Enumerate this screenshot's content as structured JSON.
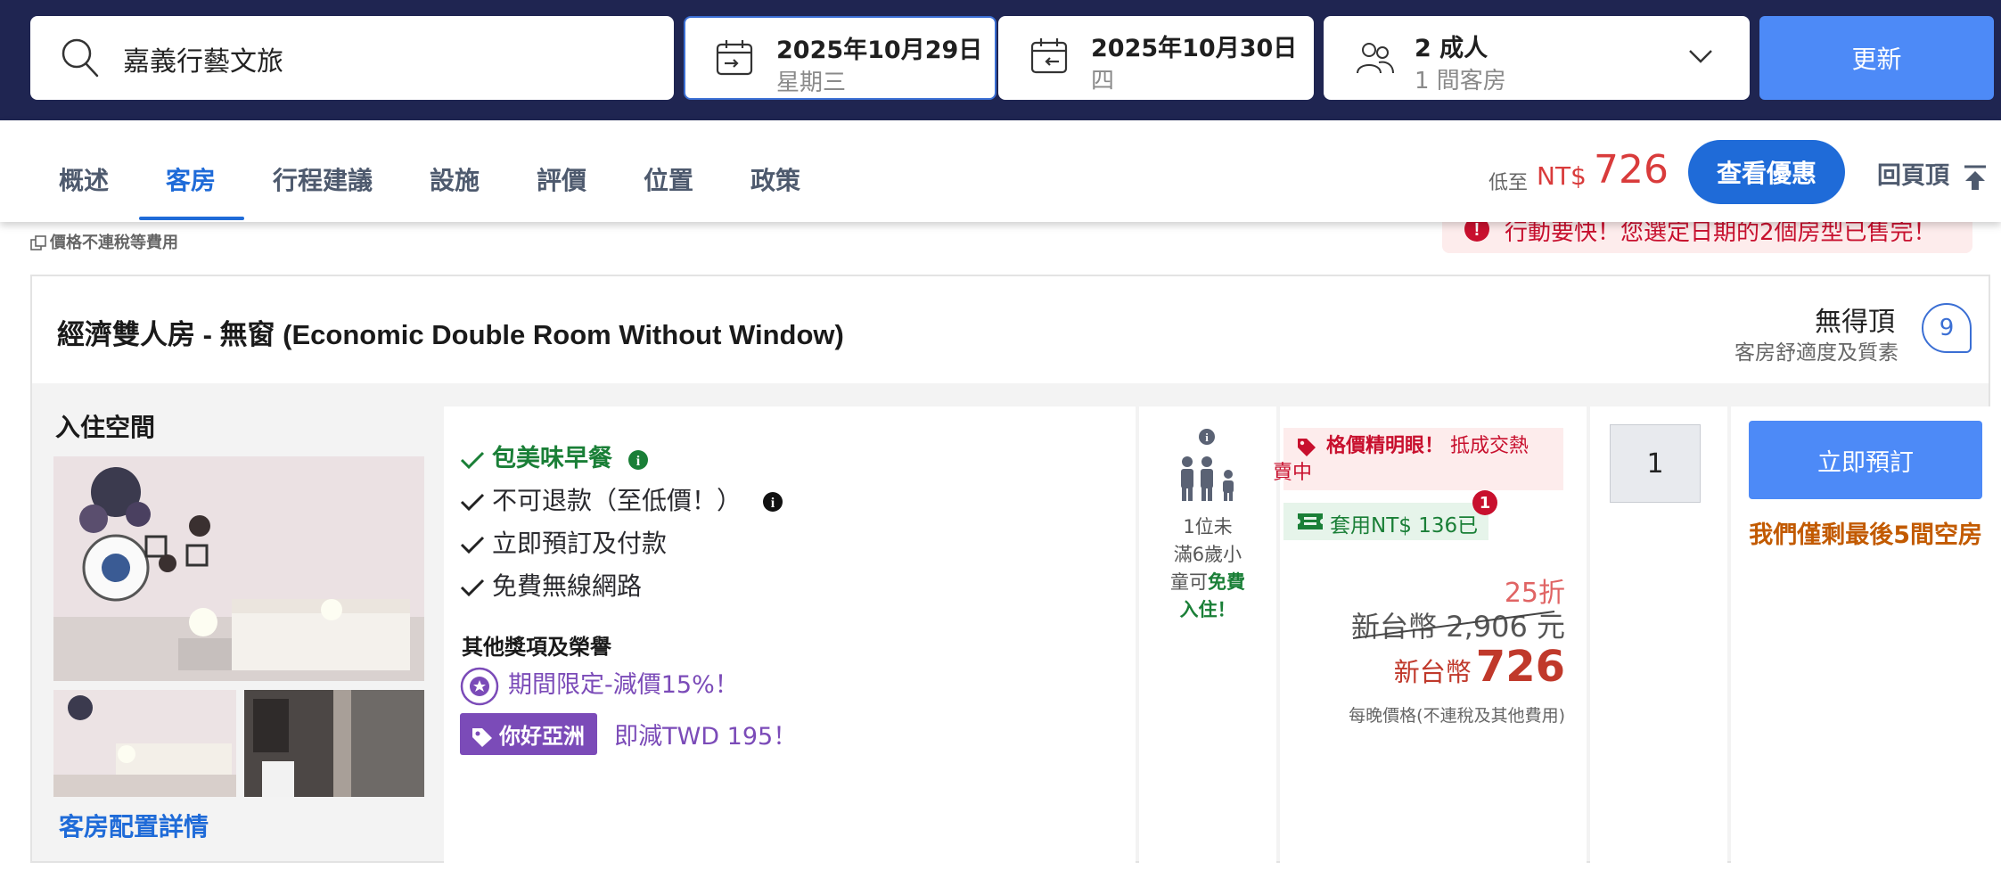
{
  "search": {
    "query": "嘉義行藝文旅",
    "icon": "search-icon"
  },
  "dates": {
    "checkin": {
      "date": "2025年10月29日",
      "weekday": "星期三"
    },
    "checkout": {
      "date": "2025年10月30日",
      "weekday": "四"
    }
  },
  "guests": {
    "adults": "2 成人",
    "rooms": "1 間客房"
  },
  "update_label": "更新",
  "tabs": [
    "概述",
    "客房",
    "行程建議",
    "設施",
    "評價",
    "位置",
    "政策"
  ],
  "active_tab": "客房",
  "header_price": {
    "prefix": "低至",
    "currency": "NT$",
    "amount": "726"
  },
  "see_deal_label": "查看優惠",
  "back_to_top_label": "回頁頂",
  "tax_note": "價格不連稅等費用",
  "urgent_banner": "行動要快！您選定日期的2個房型已售完！",
  "room": {
    "title": "經濟雙人房 - 無窗 (Economic Double Room Without Window)",
    "rating_text": "無得頂",
    "rating_sub": "客房舒適度及質素",
    "rating_score": "9",
    "space_label": "入住空間",
    "details_link": "客房配置詳情",
    "features": {
      "breakfast": "包美味早餐",
      "nonrefund": "不可退款（至低價！）",
      "instant": "立即預訂及付款",
      "wifi": "免費無線網路"
    },
    "awards_title": "其他獎項及榮譽",
    "award1": "期間限定-減價15%！",
    "award2_badge": "你好亞洲",
    "award2_text": "即減TWD 195！",
    "occupancy": {
      "line1": "1位未",
      "line2": "滿6歲小",
      "line3": "童可",
      "free": "免費",
      "line4": "入住！"
    },
    "deal_tag": {
      "bold": "格價精明眼！",
      "text": "抵成交熱",
      "text2": "賣中"
    },
    "coupon": {
      "text": "套用NT$ 136已",
      "count": "1"
    },
    "discount": "25折",
    "original_price": "新台幣 2,906 元",
    "final_price": {
      "prefix": "新台幣",
      "amount": "726"
    },
    "price_note": "每晚價格(不連稅及其他費用)",
    "qty": "1",
    "book_label": "立即預訂",
    "scarcity": "我們僅剩最後5間空房"
  },
  "colors": {
    "brand_blue": "#1f6bd8",
    "update_blue": "#4d8af7",
    "price_red": "#c0392b",
    "green": "#1a7f37",
    "purple": "#7b4bb8"
  }
}
